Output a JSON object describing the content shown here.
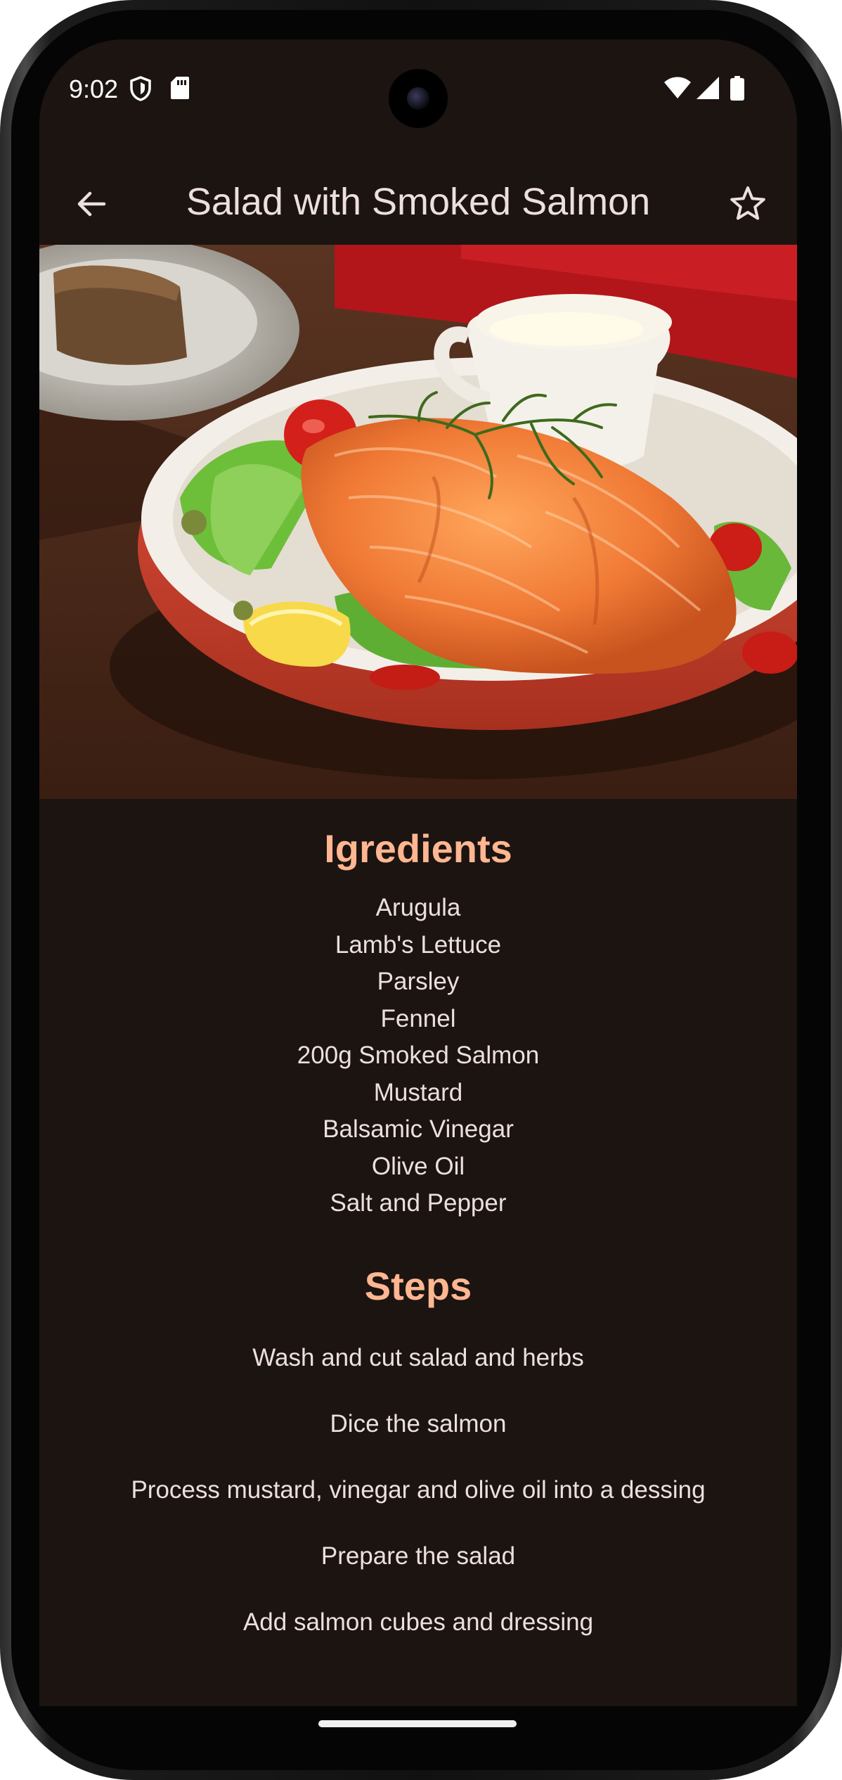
{
  "status_bar": {
    "time": "9:02"
  },
  "app_bar": {
    "title": "Salad with Smoked Salmon",
    "back_icon": "arrow-back-icon",
    "favorite_icon": "star-outline-icon"
  },
  "ingredients": {
    "heading": "Igredients",
    "items": [
      "Arugula",
      "Lamb's Lettuce",
      "Parsley",
      "Fennel",
      "200g Smoked Salmon",
      "Mustard",
      "Balsamic Vinegar",
      "Olive Oil",
      "Salt and Pepper"
    ]
  },
  "steps": {
    "heading": "Steps",
    "items": [
      "Wash and cut salad and herbs",
      "Dice the salmon",
      "Process mustard, vinegar and olive oil into a dessing",
      "Prepare the salad",
      "Add salmon cubes and dressing"
    ]
  },
  "colors": {
    "background": "#1b1411",
    "accent": "#ffb691",
    "text": "#ede0dc"
  }
}
